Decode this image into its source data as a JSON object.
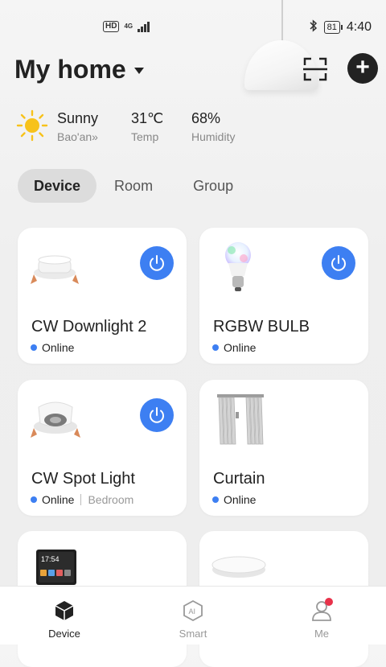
{
  "status_bar": {
    "hd": "HD",
    "network": "4G",
    "battery": "81",
    "time": "4:40"
  },
  "header": {
    "title": "My home"
  },
  "weather": {
    "condition": "Sunny",
    "location": "Bao'an",
    "temperature": "31℃",
    "temperature_label": "Temp",
    "humidity": "68%",
    "humidity_label": "Humidity"
  },
  "tabs": [
    {
      "label": "Device",
      "active": true
    },
    {
      "label": "Room",
      "active": false
    },
    {
      "label": "Group",
      "active": false
    }
  ],
  "devices": [
    {
      "name": "CW Downlight 2",
      "status": "Online",
      "room": "",
      "has_power": true
    },
    {
      "name": "RGBW BULB",
      "status": "Online",
      "room": "",
      "has_power": true
    },
    {
      "name": "CW Spot Light",
      "status": "Online",
      "room": "Bedroom",
      "has_power": true
    },
    {
      "name": "Curtain",
      "status": "Online",
      "room": "",
      "has_power": false
    },
    {
      "name": "",
      "status": "",
      "room": "",
      "has_power": false,
      "screen_time": "17:54"
    },
    {
      "name": "",
      "status": "",
      "room": "",
      "has_power": false
    }
  ],
  "bottom_nav": [
    {
      "label": "Device",
      "icon": "cube-icon",
      "active": true
    },
    {
      "label": "Smart",
      "icon": "ai-icon",
      "active": false
    },
    {
      "label": "Me",
      "icon": "person-icon",
      "active": false,
      "badge": true
    }
  ],
  "colors": {
    "accent": "#3d7ff2",
    "badge": "#e8324a",
    "text": "#222222"
  }
}
